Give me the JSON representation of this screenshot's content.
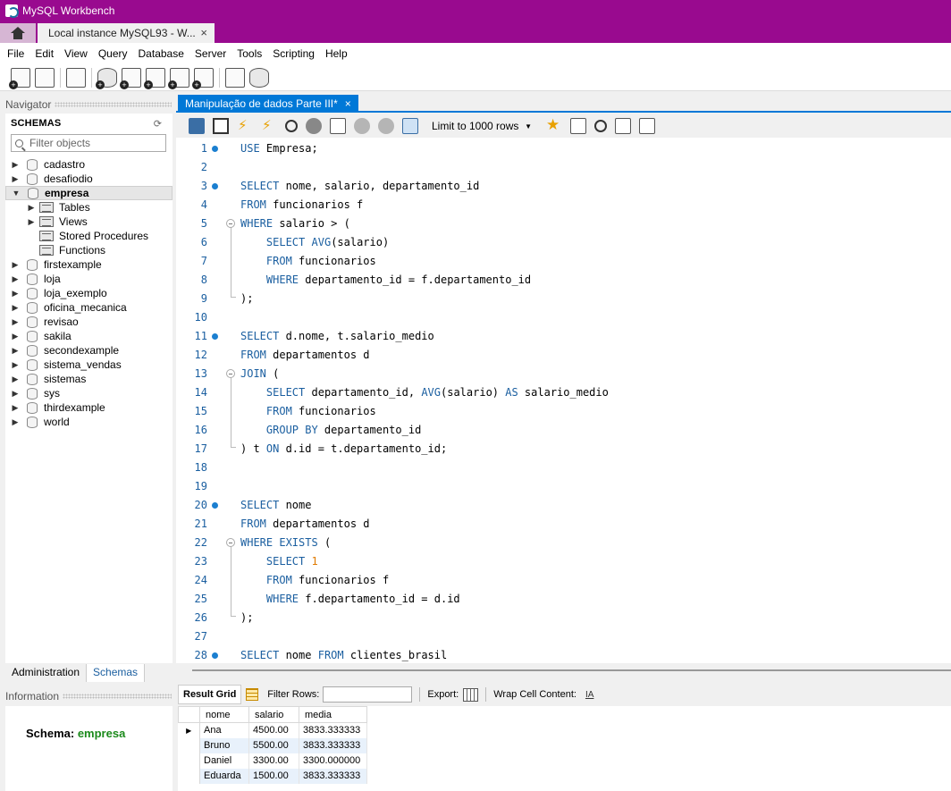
{
  "window": {
    "title": "MySQL Workbench"
  },
  "tabs": {
    "connection_tab": "Local instance MySQL93 - W...",
    "close": "×"
  },
  "menu": [
    "File",
    "Edit",
    "View",
    "Query",
    "Database",
    "Server",
    "Tools",
    "Scripting",
    "Help"
  ],
  "navigator": {
    "header": "Navigator",
    "schemas_title": "SCHEMAS",
    "filter_placeholder": "Filter objects",
    "schemas": [
      "cadastro",
      "desafiodio",
      "empresa",
      "firstexample",
      "loja",
      "loja_exemplo",
      "oficina_mecanica",
      "revisao",
      "sakila",
      "secondexample",
      "sistema_vendas",
      "sistemas",
      "sys",
      "thirdexample",
      "world"
    ],
    "expanded_schema": "empresa",
    "empresa_children": [
      "Tables",
      "Views",
      "Stored Procedures",
      "Functions"
    ],
    "bottom_tabs": [
      "Administration",
      "Schemas"
    ]
  },
  "information": {
    "header": "Information",
    "schema_label": "Schema:",
    "schema_value": "empresa"
  },
  "editor": {
    "tab_title": "Manipulação de dados Parte III*",
    "tab_close": "×",
    "limit_label": "Limit to 1000 rows",
    "lines": [
      {
        "n": "1",
        "dot": true,
        "text": "USE Empresa;"
      },
      {
        "n": "2",
        "dot": false,
        "text": ""
      },
      {
        "n": "3",
        "dot": true,
        "text": "SELECT nome, salario, departamento_id"
      },
      {
        "n": "4",
        "dot": false,
        "text": "FROM funcionarios f"
      },
      {
        "n": "5",
        "dot": false,
        "text": "WHERE salario > ("
      },
      {
        "n": "6",
        "dot": false,
        "text": "    SELECT AVG(salario)"
      },
      {
        "n": "7",
        "dot": false,
        "text": "    FROM funcionarios"
      },
      {
        "n": "8",
        "dot": false,
        "text": "    WHERE departamento_id = f.departamento_id"
      },
      {
        "n": "9",
        "dot": false,
        "text": ");"
      },
      {
        "n": "10",
        "dot": false,
        "text": ""
      },
      {
        "n": "11",
        "dot": true,
        "text": "SELECT d.nome, t.salario_medio"
      },
      {
        "n": "12",
        "dot": false,
        "text": "FROM departamentos d"
      },
      {
        "n": "13",
        "dot": false,
        "text": "JOIN ("
      },
      {
        "n": "14",
        "dot": false,
        "text": "    SELECT departamento_id, AVG(salario) AS salario_medio"
      },
      {
        "n": "15",
        "dot": false,
        "text": "    FROM funcionarios"
      },
      {
        "n": "16",
        "dot": false,
        "text": "    GROUP BY departamento_id"
      },
      {
        "n": "17",
        "dot": false,
        "text": ") t ON d.id = t.departamento_id;"
      },
      {
        "n": "18",
        "dot": false,
        "text": ""
      },
      {
        "n": "19",
        "dot": false,
        "text": ""
      },
      {
        "n": "20",
        "dot": true,
        "text": "SELECT nome"
      },
      {
        "n": "21",
        "dot": false,
        "text": "FROM departamentos d"
      },
      {
        "n": "22",
        "dot": false,
        "text": "WHERE EXISTS ("
      },
      {
        "n": "23",
        "dot": false,
        "text": "    SELECT 1"
      },
      {
        "n": "24",
        "dot": false,
        "text": "    FROM funcionarios f"
      },
      {
        "n": "25",
        "dot": false,
        "text": "    WHERE f.departamento_id = d.id"
      },
      {
        "n": "26",
        "dot": false,
        "text": ");"
      },
      {
        "n": "27",
        "dot": false,
        "text": ""
      },
      {
        "n": "28",
        "dot": true,
        "text": "SELECT nome FROM clientes_brasil"
      }
    ]
  },
  "results": {
    "tab_label": "Result Grid",
    "filter_label": "Filter Rows:",
    "export_label": "Export:",
    "wrap_label": "Wrap Cell Content:",
    "columns": [
      "nome",
      "salario",
      "media"
    ],
    "rows": [
      [
        "Ana",
        "4500.00",
        "3833.333333"
      ],
      [
        "Bruno",
        "5500.00",
        "3833.333333"
      ],
      [
        "Daniel",
        "3300.00",
        "3300.000000"
      ],
      [
        "Eduarda",
        "1500.00",
        "3833.333333"
      ]
    ]
  },
  "colors": {
    "titlebar": "#990a8f",
    "accent": "#0078d7",
    "keyword": "#1b5fa0",
    "schema_value": "#1b8a1b"
  }
}
